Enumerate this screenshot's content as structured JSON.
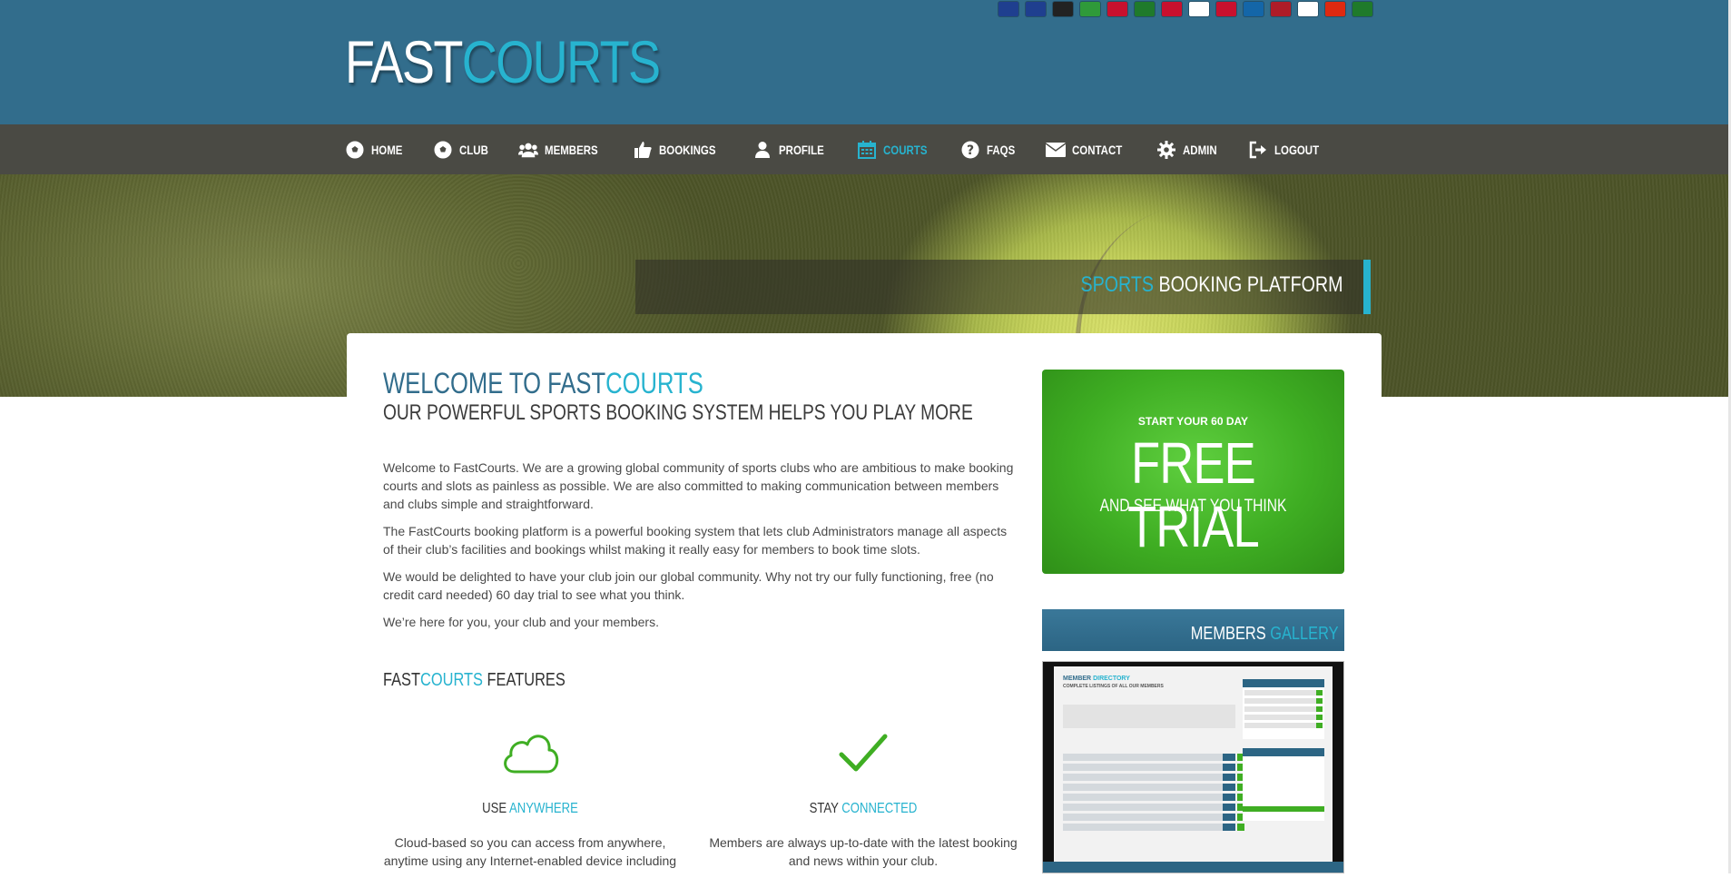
{
  "brand": {
    "fast": "FAST",
    "courts": "COURTS"
  },
  "languages": [
    {
      "name": "english-flag-icon",
      "color": "#1f3f8f"
    },
    {
      "name": "french-flag-icon",
      "color": "#1f3f8f"
    },
    {
      "name": "german-flag-icon",
      "color": "#222222"
    },
    {
      "name": "italian-flag-icon",
      "color": "#2f9a3a"
    },
    {
      "name": "spanish-flag-icon",
      "color": "#c8102e"
    },
    {
      "name": "portuguese-flag-icon",
      "color": "#1f7a2b"
    },
    {
      "name": "danish-flag-icon",
      "color": "#c8102e"
    },
    {
      "name": "finnish-flag-icon",
      "color": "#ffffff"
    },
    {
      "name": "norwegian-flag-icon",
      "color": "#c8102e"
    },
    {
      "name": "swedish-flag-icon",
      "color": "#1466a8"
    },
    {
      "name": "dutch-flag-icon",
      "color": "#ae1c28"
    },
    {
      "name": "russian-flag-icon",
      "color": "#ffffff"
    },
    {
      "name": "chinese-flag-icon",
      "color": "#de2910"
    },
    {
      "name": "arabic-flag-icon",
      "color": "#1f7a2b"
    }
  ],
  "nav": [
    {
      "label": "HOME",
      "icon": "soccer-ball-icon"
    },
    {
      "label": "CLUB",
      "icon": "soccer-ball-icon"
    },
    {
      "label": "MEMBERS",
      "icon": "users-icon"
    },
    {
      "label": "BOOKINGS",
      "icon": "thumbs-up-icon"
    },
    {
      "label": "PROFILE",
      "icon": "user-icon"
    },
    {
      "label": "COURTS",
      "icon": "calendar-icon",
      "active": true
    },
    {
      "label": "FAQS",
      "icon": "question-icon"
    },
    {
      "label": "CONTACT",
      "icon": "envelope-icon"
    },
    {
      "label": "ADMIN",
      "icon": "gear-icon"
    },
    {
      "label": "LOGOUT",
      "icon": "logout-icon"
    }
  ],
  "hero": {
    "tag1": "SPORTS",
    "tag2": "BOOKING PLATFORM"
  },
  "welcome": {
    "title1": "WELCOME TO FAST",
    "title2": "COURTS",
    "subtitle": "OUR POWERFUL SPORTS BOOKING SYSTEM HELPS YOU PLAY MORE",
    "paragraphs": [
      "Welcome to FastCourts. We are a growing global community of sports clubs who are ambitious to make booking courts and slots as painless as possible. We are also committed to making communication between members and clubs simple and straightforward.",
      "The FastCourts booking platform is a powerful booking system that lets club Administrators manage all aspects of their club’s facilities and bookings whilst making it really easy for members to book time slots.",
      "We would be delighted to have your club join our global community. Why not try our fully functioning, free (no credit card needed) 60 day trial to see what you think.",
      "We’re here for you, your club and your members."
    ]
  },
  "features": {
    "title_fast": "FAST",
    "title_courts": "COURTS",
    "title_rest": " FEATURES",
    "items": [
      {
        "t1": "USE ",
        "t2": "ANYWHERE",
        "desc": "Cloud-based so you can access from anywhere, anytime using any Internet-enabled device including"
      },
      {
        "t1": "STAY ",
        "t2": "CONNECTED",
        "desc": "Members are always up-to-date with the latest booking and news within your club."
      }
    ]
  },
  "trial": {
    "small": "START YOUR 60 DAY",
    "big": "FREE TRIAL",
    "sub": "AND SEE WHAT YOU THINK"
  },
  "gallery": {
    "t1": "MEMBERS ",
    "t2": "GALLERY",
    "shot_title1": "MEMBER ",
    "shot_title2": "DIRECTORY",
    "shot_sub": "COMPLETE LISTINGS OF ALL OUR MEMBERS"
  },
  "colors": {
    "header": "#326d8c",
    "accent": "#27b3cf",
    "nav": "#4a4a44",
    "trial": "#3fae23"
  }
}
